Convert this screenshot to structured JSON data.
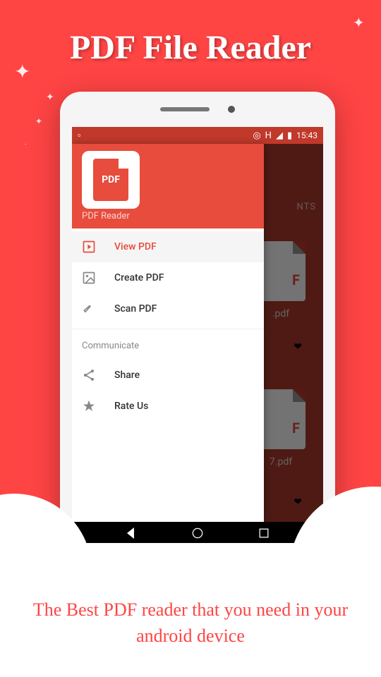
{
  "promo": {
    "title": "PDF File Reader",
    "tagline": "The Best PDF reader that you need in your android device"
  },
  "status_bar": {
    "time": "15:43",
    "signal_label": "H"
  },
  "background_app": {
    "tab_partial": "NTS",
    "files": [
      {
        "name_partial": ".pdf"
      },
      {
        "name_partial": "7.pdf"
      }
    ]
  },
  "drawer": {
    "app_name": "PDF Reader",
    "logo_text": "PDF",
    "sections": {
      "main": [
        {
          "label": "View PDF",
          "active": true
        },
        {
          "label": "Create PDF",
          "active": false
        },
        {
          "label": "Scan PDF",
          "active": false
        }
      ],
      "communicate": {
        "heading": "Communicate",
        "items": [
          {
            "label": "Share"
          },
          {
            "label": "Rate Us"
          }
        ]
      }
    }
  }
}
